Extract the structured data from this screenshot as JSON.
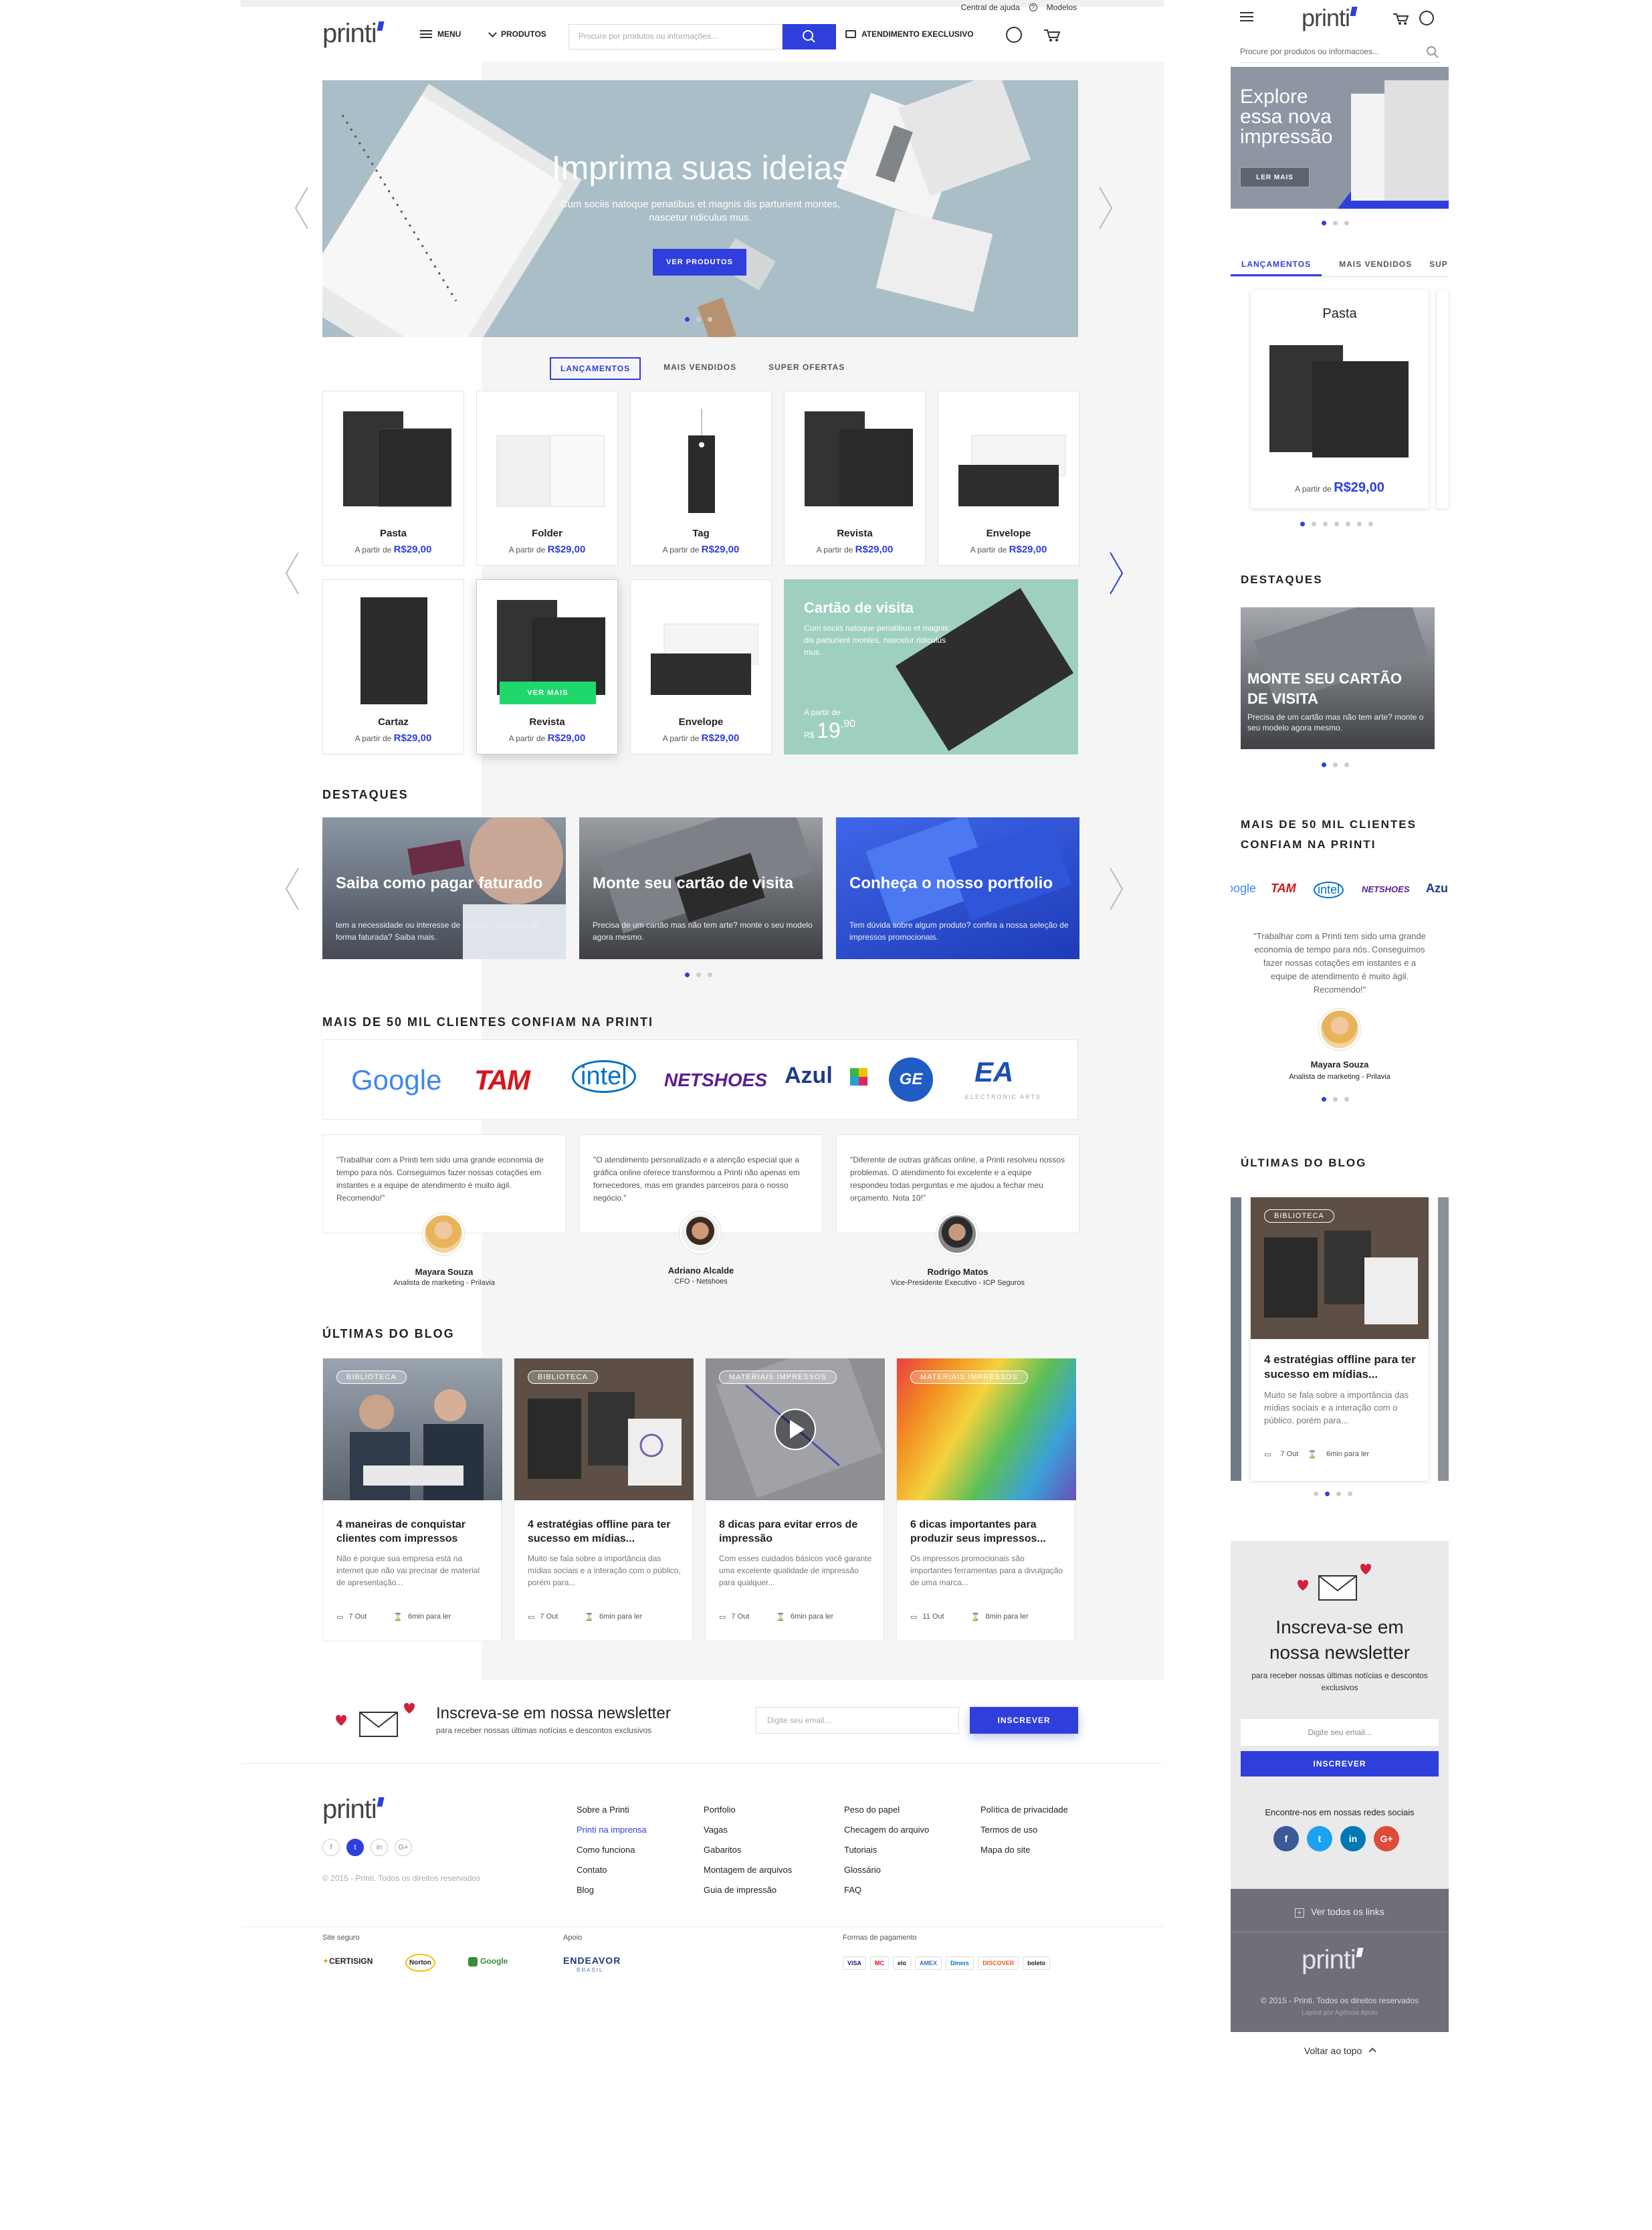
{
  "header": {
    "help_link": "Central de ajuda",
    "models_link": "Modelos",
    "logo": "printi",
    "menu_label": "MENU",
    "products_label": "PRODUTOS",
    "search_placeholder": "Procure por produtos ou informações...",
    "exclusive_label": "ATENDIMENTO EXECLUSIVO"
  },
  "hero": {
    "title": "Imprima suas ideias",
    "subtitle_line1": "Cum sociis natoque penatibus et magnis dis parturient montes,",
    "subtitle_line2": "nascetur ridiculus mus.",
    "button": "VER PRODUTOS"
  },
  "tabs": [
    "LANÇAMENTOS",
    "MAIS VENDIDOS",
    "SUPER OFERTAS"
  ],
  "products": {
    "price_prefix": "A partir de",
    "row1": [
      {
        "name": "Pasta",
        "price": "R$29,00"
      },
      {
        "name": "Folder",
        "price": "R$29,00"
      },
      {
        "name": "Tag",
        "price": "R$29,00"
      },
      {
        "name": "Revista",
        "price": "R$29,00"
      },
      {
        "name": "Envelope",
        "price": "R$29,00"
      }
    ],
    "row2": [
      {
        "name": "Cartaz",
        "price": "R$29,00"
      },
      {
        "name": "Revista",
        "price": "R$29,00",
        "button": "VER MAIS"
      },
      {
        "name": "Envelope",
        "price": "R$29,00"
      }
    ],
    "featured": {
      "title": "Cartão de visita",
      "text": "Cum sociis natoque penatibus et magnis dis parturient montes, nascetur ridiculus mus.",
      "price_prefix": "A partir de",
      "currency": "R$",
      "price_int": "19",
      "price_dec": ",90"
    }
  },
  "destaques": {
    "title": "DESTAQUES",
    "cards": [
      {
        "title": "Saiba como pagar faturado",
        "text": "tem a necessidade ou interesse de adquirir impressos de forma faturada? Saiba mais."
      },
      {
        "title": "Monte seu cartão de visita",
        "text": "Precisa de um cartão mas não tem arte? monte o seu modelo agora mesmo."
      },
      {
        "title": "Conheça o nosso portfolio",
        "text": "Tem dúvida sobre algum produto? confira a nossa seleção de impressos promocionais."
      }
    ]
  },
  "clients": {
    "title": "MAIS DE 50 MIL CLIENTES CONFIAM NA PRINTI",
    "logos": [
      "Google",
      "TAM",
      "intel",
      "NETSHOES",
      "Azul",
      "GE",
      "EA"
    ],
    "ea_sub": "ELECTRONIC ARTS"
  },
  "testimonials": [
    {
      "text": "\"Trabalhar com a Printi tem sido uma grande economia de tempo para nós. Conseguimos fazer nossas cotações em instantes e a equipe de atendimento é muito ágil. Recomendo!\"",
      "name": "Mayara Souza",
      "role": "Analista de marketing - Prilavia"
    },
    {
      "text": "\"O atendimento personalizado e a atenção especial que a gráfica online oferece transformou a Printi não apenas em fornecedores, mas em grandes parceiros para o nosso negócio.\"",
      "name": "Adriano Alcalde",
      "role": "CFO - Netshoes"
    },
    {
      "text": "\"Diferente de outras gráficas online, a Printi resolveu nossos problemas. O atendimento foi excelente e a equipe respondeu todas perguntas e me ajudou a fechar meu orçamento. Nota 10!\"",
      "name": "Rodrigo Matos",
      "role": "Vice-Presidente Executivo - ICP Seguros"
    }
  ],
  "blog": {
    "title": "ÚLTIMAS DO BLOG",
    "posts": [
      {
        "tag": "BIBLIOTECA",
        "title": "4 maneiras de conquistar clientes com impressos",
        "text": "Não é porque sua empresa está na internet que não vai precisar de material de apresentação...",
        "date": "7 Out",
        "read": "6min para ler"
      },
      {
        "tag": "BIBLIOTECA",
        "title": "4 estratégias offline para ter sucesso em mídias...",
        "text": "Muito se fala sobre a importância das mídias sociais e a interação com o público, porém para...",
        "date": "7 Out",
        "read": "6min para ler"
      },
      {
        "tag": "MATERIAIS IMPRESSOS",
        "title": "8 dicas para evitar erros de impressão",
        "text": "Com esses cuidados básicos você garante uma excelente qualidade de impressão para qualquer...",
        "date": "7 Out",
        "read": "6min para ler"
      },
      {
        "tag": "MATERIAIS IMPRESSOS",
        "title": "6 dicas importantes para produzir seus impressos...",
        "text": "Os impressos promocionais são importantes ferramentas para a divulgação de uma marca...",
        "date": "11 Out",
        "read": "8min para ler"
      }
    ]
  },
  "newsletter": {
    "title": "Inscreva-se em nossa newsletter",
    "subtitle": "para receber nossas últimas notícias e descontos exclusivos",
    "placeholder": "Digite seu email...",
    "button": "INSCREVER"
  },
  "footer": {
    "copyright": "© 2015 - Printi. Todos os direitos reservados",
    "col1": [
      "Sobre a Printi",
      "Printi na imprensa",
      "Como funciona",
      "Contato",
      "Blog"
    ],
    "col2": [
      "Portfolio",
      "Vagas",
      "Gabaritos",
      "Montagem de arquivos",
      "Guia de impressão"
    ],
    "col3": [
      "Peso do papel",
      "Checagem do arquivo",
      "Tutoriais",
      "Glossário",
      "FAQ"
    ],
    "col4": [
      "Política de privacidade",
      "Termos de uso",
      "Mapa do site"
    ],
    "safe_site": "Site seguro",
    "support": "Apoio",
    "payments": "Formas de pagamento",
    "seals": [
      "CERTISIGN",
      "Norton",
      "Google"
    ],
    "endeavor": "ENDEAVOR",
    "endeavor_sub": "BRASIL",
    "pay_methods": [
      "VISA",
      "MC",
      "elo",
      "AMEX",
      "Diners",
      "DISCOVER",
      "boleto"
    ]
  },
  "mobile": {
    "search_placeholder": "Procure por produtos ou informacoes...",
    "hero_title_l1": "Explore",
    "hero_title_l2": "essa nova",
    "hero_title_l3": "impressão",
    "hero_button": "LER MAIS",
    "tabs": [
      "LANÇAMENTOS",
      "MAIS VENDIDOS",
      "SUP"
    ],
    "product_name": "Pasta",
    "price_prefix": "A partir de",
    "price": "R$29,00",
    "destaques_title": "DESTAQUES",
    "destaque_card_title": "MONTE SEU CARTÃO DE VISITA",
    "destaque_card_text": "Precisa de um cartão mas não tem arte? monte o seu modelo agora mesmo.",
    "clients_title_l1": "MAIS DE 50 MIL CLIENTES",
    "clients_title_l2": "CONFIAM NA PRINTI",
    "testimonial": "\"Trabalhar com a Printi tem sido uma grande economia de tempo para nós. Conseguimos fazer nossas cotações em instantes e a equipe de atendimento é muito ágil. Recomendo!\"",
    "t_name": "Mayara Souza",
    "t_role": "Analista de marketing - Prilavia",
    "blog_title": "ÚLTIMAS DO BLOG",
    "blog_tag": "BIBLIOTECA",
    "blog_post_title": "4 estratégias offline para ter sucesso em mídias...",
    "blog_post_text": "Muito se fala sobre a importância das mídias sociais e a interação com o público, porém para...",
    "blog_date": "7 Out",
    "blog_read": "6min para ler",
    "nl_title_l1": "Inscreva-se em",
    "nl_title_l2": "nossa newsletter",
    "nl_subtitle": "para receber nossas últimas notícias e descontos exclusivos",
    "nl_placeholder": "Digite seu email...",
    "nl_button": "INSCREVER",
    "social_label": "Encontre-nos em nossas redes sociais",
    "see_all": "Ver todos os links",
    "copyright": "© 2015 - Printi. Todos os direitos reservados",
    "layout_by": "Layout por Agência Apolo",
    "back_top": "Voltar ao topo"
  },
  "colors": {
    "accent": "#2f3fdc",
    "green": "#1ed86b",
    "teal": "#9fcfc0"
  }
}
